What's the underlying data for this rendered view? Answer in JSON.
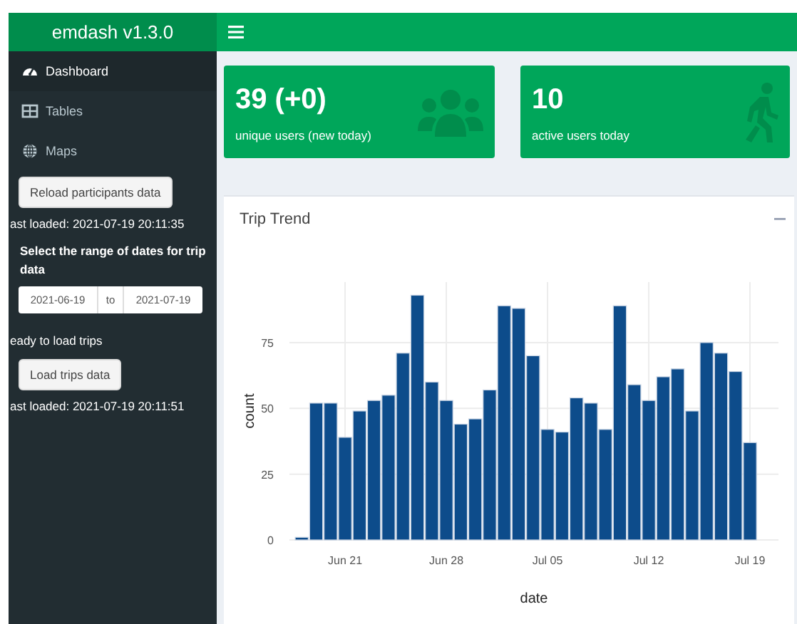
{
  "header": {
    "title": "emdash v1.3.0"
  },
  "sidebar": {
    "items": [
      {
        "label": "Dashboard",
        "selected": true
      },
      {
        "label": "Tables",
        "selected": false
      },
      {
        "label": "Maps",
        "selected": false
      }
    ],
    "controls": [
      {
        "kind": "button",
        "label": "Reload participants data"
      },
      {
        "kind": "text",
        "text": "ast loaded: 2021-07-19 20:11:35"
      },
      {
        "kind": "heading",
        "text": "Select the range of dates for trip data"
      },
      {
        "kind": "daterange",
        "start": "2021-06-19",
        "separator": "to",
        "end": "2021-07-19"
      },
      {
        "kind": "text",
        "text": "eady to load trips"
      },
      {
        "kind": "button",
        "label": "Load trips data"
      },
      {
        "kind": "text",
        "text": "ast loaded: 2021-07-19 20:11:51"
      }
    ]
  },
  "value_boxes": [
    {
      "value": "39 (+0)",
      "caption": "unique users (new today)"
    },
    {
      "value": "10",
      "caption": "active users today"
    }
  ],
  "trend_box": {
    "title": "Trip Trend",
    "chart_data": {
      "type": "bar",
      "xlabel": "date",
      "ylabel": "count",
      "categories": [
        null,
        null,
        null,
        "Jun 21",
        null,
        null,
        null,
        null,
        null,
        null,
        "Jun 28",
        null,
        null,
        null,
        null,
        null,
        null,
        "Jul 05",
        null,
        null,
        null,
        null,
        null,
        null,
        "Jul 12",
        null,
        null,
        null,
        null,
        null,
        null,
        "Jul 19"
      ],
      "series": [
        {
          "color": "#0d4c8b",
          "values": [
            1,
            52,
            52,
            39,
            49,
            53,
            55,
            71,
            93,
            60,
            53,
            44,
            46,
            57,
            89,
            88,
            70,
            42,
            41,
            54,
            52,
            42,
            89,
            59,
            53,
            62,
            65,
            49,
            75,
            71,
            64,
            37
          ]
        }
      ],
      "ylim": [
        0,
        98
      ],
      "grid": true,
      "yticks": [
        0,
        25,
        50,
        75
      ]
    }
  }
}
